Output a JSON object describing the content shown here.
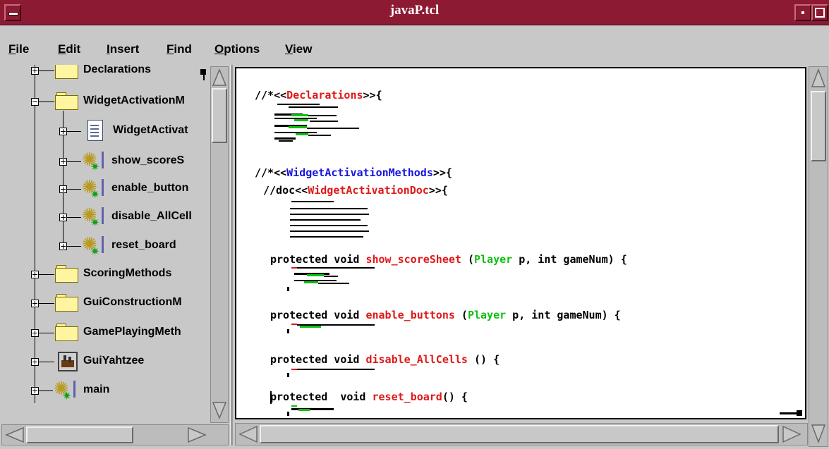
{
  "window": {
    "title": "javaP.tcl"
  },
  "menubar": {
    "items": [
      {
        "label": "File"
      },
      {
        "label": "Edit"
      },
      {
        "label": "Insert"
      },
      {
        "label": "Find"
      },
      {
        "label": "Options"
      },
      {
        "label": "View"
      }
    ]
  },
  "tree": {
    "items": [
      {
        "label": "Declarations",
        "icon": "folder-icon",
        "level": 0,
        "expanded": false
      },
      {
        "label": "WidgetActivationM",
        "icon": "folder-icon",
        "level": 0,
        "expanded": true
      },
      {
        "label": "WidgetActivat",
        "icon": "document-icon",
        "level": 1,
        "expanded": false
      },
      {
        "label": "show_scoreS",
        "icon": "gear-icon",
        "level": 1,
        "expanded": false
      },
      {
        "label": "enable_button",
        "icon": "gear-icon",
        "level": 1,
        "expanded": false
      },
      {
        "label": "disable_AllCell",
        "icon": "gear-icon",
        "level": 1,
        "expanded": false
      },
      {
        "label": "reset_board",
        "icon": "gear-icon",
        "level": 1,
        "expanded": false
      },
      {
        "label": "ScoringMethods",
        "icon": "folder-icon",
        "level": 0,
        "expanded": false
      },
      {
        "label": "GuiConstructionM",
        "icon": "folder-icon",
        "level": 0,
        "expanded": false
      },
      {
        "label": "GamePlayingMeth",
        "icon": "folder-icon",
        "level": 0,
        "expanded": false
      },
      {
        "label": "GuiYahtzee",
        "icon": "application-icon",
        "level": 0,
        "expanded": false
      },
      {
        "label": "main",
        "icon": "gear-icon",
        "level": 0,
        "expanded": false
      }
    ]
  },
  "editor": {
    "decl_prefix": "//*<<",
    "decl_name": "Declarations",
    "decl_suffix": ">>{",
    "wam_prefix": "//*<<",
    "wam_name": "WidgetActivationMethods",
    "wam_suffix": ">>{",
    "doc_prefix": "//doc<<",
    "doc_name": "WidgetActivationDoc",
    "doc_suffix": ">>{",
    "m1_prefix": "protected void ",
    "m1_name": "show_scoreSheet",
    "m1_mid1": " (",
    "m1_type": "Player",
    "m1_mid2": " p, int gameNum) {",
    "m2_prefix": "protected void ",
    "m2_name": "enable_buttons",
    "m2_mid1": " (",
    "m2_type": "Player",
    "m2_mid2": " p, int gameNum) {",
    "m3_prefix": "protected void ",
    "m3_name": "disable_AllCells",
    "m3_suffix": " () {",
    "m4_prefix": "protected  void ",
    "m4_name": "reset_board",
    "m4_suffix": "() {"
  },
  "colors": {
    "titlebar": "#8c1a32",
    "keyword_red": "#e01818",
    "keyword_blue": "#1414e0",
    "keyword_green": "#10c010"
  }
}
